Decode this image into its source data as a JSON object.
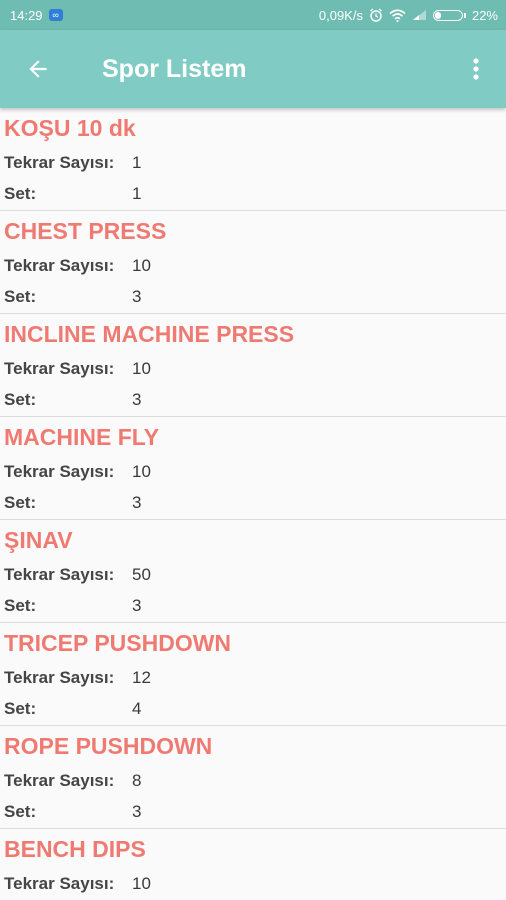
{
  "status_bar": {
    "time": "14:29",
    "network_speed": "0,09K/s",
    "battery_percent": "22%",
    "battery_level": 0.22,
    "icons": [
      "notification-icon",
      "alarm-icon",
      "wifi-icon",
      "signal-icon",
      "battery-icon"
    ]
  },
  "app_bar": {
    "title": "Spor Listem",
    "back_icon": "arrow-left-icon",
    "menu_icon": "more-vert-icon"
  },
  "colors": {
    "status_bar": "#6fbcb2",
    "app_bar": "#80cbc4",
    "exercise_title": "#ef7a72",
    "text": "#454545",
    "divider": "#dcdcdc"
  },
  "labels": {
    "reps": "Tekrar Sayısı:",
    "sets": "Set:"
  },
  "exercises": [
    {
      "name": "KOŞU 10 dk",
      "reps": "1",
      "sets": "1"
    },
    {
      "name": "CHEST PRESS",
      "reps": "10",
      "sets": "3"
    },
    {
      "name": "INCLINE MACHINE PRESS",
      "reps": "10",
      "sets": "3"
    },
    {
      "name": "MACHINE FLY",
      "reps": "10",
      "sets": "3"
    },
    {
      "name": "ŞINAV",
      "reps": "50",
      "sets": "3"
    },
    {
      "name": "TRICEP PUSHDOWN",
      "reps": "12",
      "sets": "4"
    },
    {
      "name": "ROPE PUSHDOWN",
      "reps": "8",
      "sets": "3"
    },
    {
      "name": "BENCH DIPS",
      "reps": "10",
      "sets": ""
    }
  ]
}
